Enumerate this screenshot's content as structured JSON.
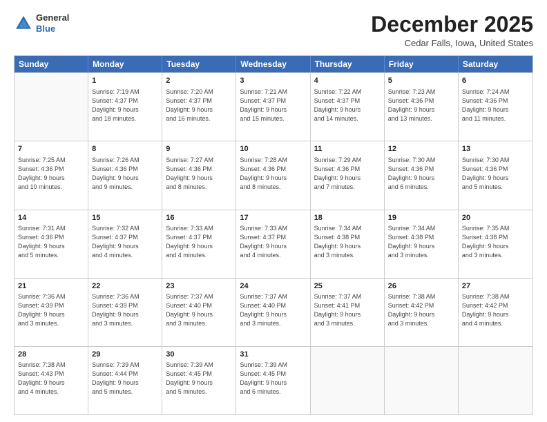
{
  "header": {
    "logo_general": "General",
    "logo_blue": "Blue",
    "main_title": "December 2025",
    "subtitle": "Cedar Falls, Iowa, United States"
  },
  "calendar": {
    "days_of_week": [
      "Sunday",
      "Monday",
      "Tuesday",
      "Wednesday",
      "Thursday",
      "Friday",
      "Saturday"
    ],
    "rows": [
      [
        {
          "day": "",
          "info": ""
        },
        {
          "day": "1",
          "info": "Sunrise: 7:19 AM\nSunset: 4:37 PM\nDaylight: 9 hours\nand 18 minutes."
        },
        {
          "day": "2",
          "info": "Sunrise: 7:20 AM\nSunset: 4:37 PM\nDaylight: 9 hours\nand 16 minutes."
        },
        {
          "day": "3",
          "info": "Sunrise: 7:21 AM\nSunset: 4:37 PM\nDaylight: 9 hours\nand 15 minutes."
        },
        {
          "day": "4",
          "info": "Sunrise: 7:22 AM\nSunset: 4:37 PM\nDaylight: 9 hours\nand 14 minutes."
        },
        {
          "day": "5",
          "info": "Sunrise: 7:23 AM\nSunset: 4:36 PM\nDaylight: 9 hours\nand 13 minutes."
        },
        {
          "day": "6",
          "info": "Sunrise: 7:24 AM\nSunset: 4:36 PM\nDaylight: 9 hours\nand 11 minutes."
        }
      ],
      [
        {
          "day": "7",
          "info": "Sunrise: 7:25 AM\nSunset: 4:36 PM\nDaylight: 9 hours\nand 10 minutes."
        },
        {
          "day": "8",
          "info": "Sunrise: 7:26 AM\nSunset: 4:36 PM\nDaylight: 9 hours\nand 9 minutes."
        },
        {
          "day": "9",
          "info": "Sunrise: 7:27 AM\nSunset: 4:36 PM\nDaylight: 9 hours\nand 8 minutes."
        },
        {
          "day": "10",
          "info": "Sunrise: 7:28 AM\nSunset: 4:36 PM\nDaylight: 9 hours\nand 8 minutes."
        },
        {
          "day": "11",
          "info": "Sunrise: 7:29 AM\nSunset: 4:36 PM\nDaylight: 9 hours\nand 7 minutes."
        },
        {
          "day": "12",
          "info": "Sunrise: 7:30 AM\nSunset: 4:36 PM\nDaylight: 9 hours\nand 6 minutes."
        },
        {
          "day": "13",
          "info": "Sunrise: 7:30 AM\nSunset: 4:36 PM\nDaylight: 9 hours\nand 5 minutes."
        }
      ],
      [
        {
          "day": "14",
          "info": "Sunrise: 7:31 AM\nSunset: 4:36 PM\nDaylight: 9 hours\nand 5 minutes."
        },
        {
          "day": "15",
          "info": "Sunrise: 7:32 AM\nSunset: 4:37 PM\nDaylight: 9 hours\nand 4 minutes."
        },
        {
          "day": "16",
          "info": "Sunrise: 7:33 AM\nSunset: 4:37 PM\nDaylight: 9 hours\nand 4 minutes."
        },
        {
          "day": "17",
          "info": "Sunrise: 7:33 AM\nSunset: 4:37 PM\nDaylight: 9 hours\nand 4 minutes."
        },
        {
          "day": "18",
          "info": "Sunrise: 7:34 AM\nSunset: 4:38 PM\nDaylight: 9 hours\nand 3 minutes."
        },
        {
          "day": "19",
          "info": "Sunrise: 7:34 AM\nSunset: 4:38 PM\nDaylight: 9 hours\nand 3 minutes."
        },
        {
          "day": "20",
          "info": "Sunrise: 7:35 AM\nSunset: 4:38 PM\nDaylight: 9 hours\nand 3 minutes."
        }
      ],
      [
        {
          "day": "21",
          "info": "Sunrise: 7:36 AM\nSunset: 4:39 PM\nDaylight: 9 hours\nand 3 minutes."
        },
        {
          "day": "22",
          "info": "Sunrise: 7:36 AM\nSunset: 4:39 PM\nDaylight: 9 hours\nand 3 minutes."
        },
        {
          "day": "23",
          "info": "Sunrise: 7:37 AM\nSunset: 4:40 PM\nDaylight: 9 hours\nand 3 minutes."
        },
        {
          "day": "24",
          "info": "Sunrise: 7:37 AM\nSunset: 4:40 PM\nDaylight: 9 hours\nand 3 minutes."
        },
        {
          "day": "25",
          "info": "Sunrise: 7:37 AM\nSunset: 4:41 PM\nDaylight: 9 hours\nand 3 minutes."
        },
        {
          "day": "26",
          "info": "Sunrise: 7:38 AM\nSunset: 4:42 PM\nDaylight: 9 hours\nand 3 minutes."
        },
        {
          "day": "27",
          "info": "Sunrise: 7:38 AM\nSunset: 4:42 PM\nDaylight: 9 hours\nand 4 minutes."
        }
      ],
      [
        {
          "day": "28",
          "info": "Sunrise: 7:38 AM\nSunset: 4:43 PM\nDaylight: 9 hours\nand 4 minutes."
        },
        {
          "day": "29",
          "info": "Sunrise: 7:39 AM\nSunset: 4:44 PM\nDaylight: 9 hours\nand 5 minutes."
        },
        {
          "day": "30",
          "info": "Sunrise: 7:39 AM\nSunset: 4:45 PM\nDaylight: 9 hours\nand 5 minutes."
        },
        {
          "day": "31",
          "info": "Sunrise: 7:39 AM\nSunset: 4:45 PM\nDaylight: 9 hours\nand 6 minutes."
        },
        {
          "day": "",
          "info": ""
        },
        {
          "day": "",
          "info": ""
        },
        {
          "day": "",
          "info": ""
        }
      ]
    ]
  }
}
